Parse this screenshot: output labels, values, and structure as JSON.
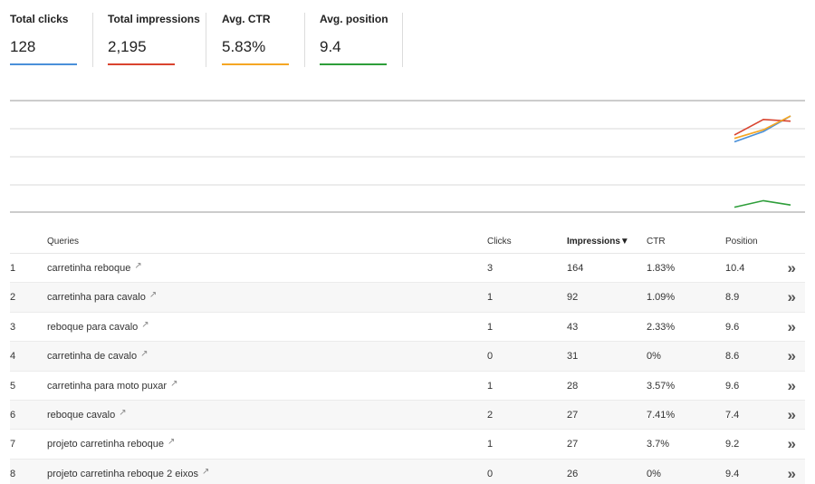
{
  "metrics": [
    {
      "label": "Total clicks",
      "value": "128",
      "color": "#4a90d9"
    },
    {
      "label": "Total impressions",
      "value": "2,195",
      "color": "#d9442f"
    },
    {
      "label": "Avg. CTR",
      "value": "5.83%",
      "color": "#f5a623"
    },
    {
      "label": "Avg. position",
      "value": "9.4",
      "color": "#2e9e3a"
    }
  ],
  "table": {
    "headers": {
      "queries": "Queries",
      "clicks": "Clicks",
      "impressions": "Impressions▼",
      "ctr": "CTR",
      "position": "Position"
    },
    "external_icon": "external-link-icon",
    "more_icon": "double-chevron-right-icon",
    "rows": [
      {
        "index": "1",
        "query": "carretinha reboque",
        "clicks": "3",
        "impressions": "164",
        "ctr": "1.83%",
        "position": "10.4"
      },
      {
        "index": "2",
        "query": "carretinha para cavalo",
        "clicks": "1",
        "impressions": "92",
        "ctr": "1.09%",
        "position": "8.9"
      },
      {
        "index": "3",
        "query": "reboque para cavalo",
        "clicks": "1",
        "impressions": "43",
        "ctr": "2.33%",
        "position": "9.6"
      },
      {
        "index": "4",
        "query": "carretinha de cavalo",
        "clicks": "0",
        "impressions": "31",
        "ctr": "0%",
        "position": "8.6"
      },
      {
        "index": "5",
        "query": "carretinha para moto puxar",
        "clicks": "1",
        "impressions": "28",
        "ctr": "3.57%",
        "position": "9.6"
      },
      {
        "index": "6",
        "query": "reboque cavalo",
        "clicks": "2",
        "impressions": "27",
        "ctr": "7.41%",
        "position": "7.4"
      },
      {
        "index": "7",
        "query": "projeto carretinha reboque",
        "clicks": "1",
        "impressions": "27",
        "ctr": "3.7%",
        "position": "9.2"
      },
      {
        "index": "8",
        "query": "projeto carretinha reboque 2 eixos",
        "clicks": "0",
        "impressions": "26",
        "ctr": "0%",
        "position": "9.4"
      }
    ]
  },
  "chart_data": {
    "type": "line",
    "title": "",
    "xlabel": "",
    "ylabel": "",
    "grid": true,
    "series": [
      {
        "name": "Total clicks",
        "color": "#4a90d9",
        "values": [
          0.25,
          0.55,
          1.0
        ]
      },
      {
        "name": "Total impressions",
        "color": "#d9442f",
        "values": [
          0.45,
          0.9,
          0.85
        ]
      },
      {
        "name": "Avg. CTR",
        "color": "#f5a623",
        "values": [
          0.35,
          0.6,
          1.0
        ]
      },
      {
        "name": "Avg. position",
        "color": "#2e9e3a",
        "values": [
          0.2,
          0.8,
          0.4
        ]
      }
    ]
  }
}
